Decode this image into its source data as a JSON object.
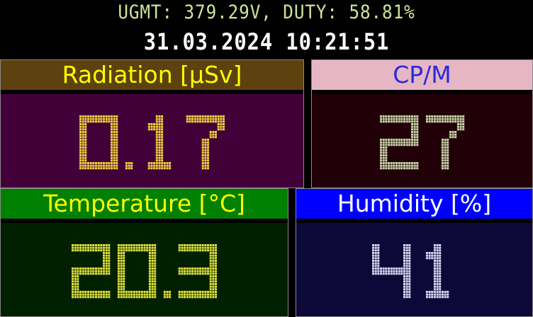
{
  "header": {
    "status_line": "UGMT: 379.29V, DUTY: 58.81%",
    "datetime": "31.03.2024   10:21:51"
  },
  "panels": {
    "radiation": {
      "title": "Radiation [µSv]",
      "value": "0.17",
      "colors": {
        "title_bg": "#5d4210",
        "title_fg": "#ffff00",
        "body_bg": "#420038",
        "digit": "#f2d23a"
      }
    },
    "cpm": {
      "title": "CP/M",
      "value": "27",
      "colors": {
        "title_bg": "#e7b6c5",
        "title_fg": "#2a2ad8",
        "body_bg": "#220008",
        "digit": "#c9d7a8"
      }
    },
    "temperature": {
      "title": "Temperature [°C]",
      "value": "20.3",
      "colors": {
        "title_bg": "#008000",
        "title_fg": "#ffff00",
        "body_bg": "#002000",
        "digit": "#e2e23a"
      }
    },
    "humidity": {
      "title": "Humidity [%]",
      "value": "41",
      "colors": {
        "title_bg": "#0000ff",
        "title_fg": "#ffffff",
        "body_bg": "#0c0838",
        "digit": "#d8d8f5"
      }
    }
  }
}
